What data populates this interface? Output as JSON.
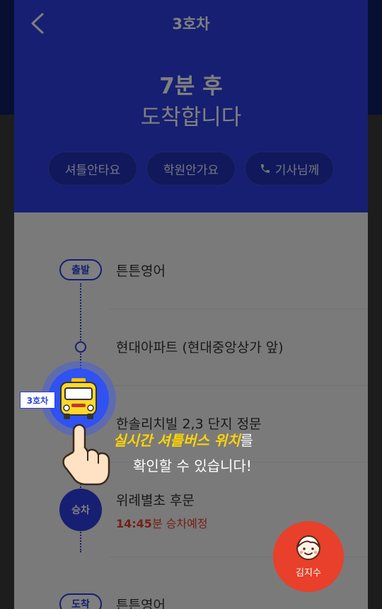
{
  "header": {
    "title": "3호차",
    "eta_line1": "7분 후",
    "eta_line2": "도착합니다",
    "buttons": {
      "not_riding": "셔틀안타요",
      "not_attending": "학원안가요",
      "call_driver": "기사님께"
    }
  },
  "route": {
    "stops": [
      {
        "badge": "출발",
        "name": "튼튼영어"
      },
      {
        "name": "현대아파트 (현대중앙상가 앞)"
      },
      {
        "name": "한솔리치빌 2,3 단지 정문"
      },
      {
        "badge": "승차",
        "name": "위례별초 후문",
        "time": "14:45",
        "time_suffix": "분 승차예정"
      },
      {
        "badge": "도착",
        "name": "튼튼영어"
      }
    ]
  },
  "bus_marker": {
    "tag": "3호차"
  },
  "tooltip": {
    "highlight": "실시간 셔틀버스 위치",
    "suffix": "를",
    "line2": "확인할 수 있습니다!"
  },
  "fab": {
    "label": "김지수"
  },
  "colors": {
    "primary": "#2c3fe2",
    "accent": "#e8402a",
    "highlight": "#ffd400"
  }
}
